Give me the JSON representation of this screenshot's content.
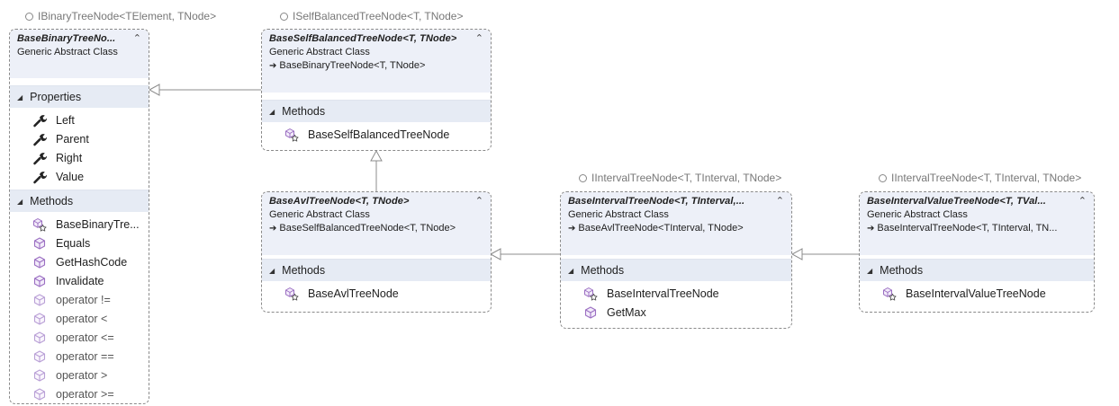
{
  "interfaces": {
    "binary": "IBinaryTreeNode<TElement, TNode>",
    "selfbal": "ISelfBalancedTreeNode<T, TNode>",
    "interval": "IIntervalTreeNode<T, TInterval, TNode>",
    "interval_value": "IIntervalTreeNode<T, TInterval, TNode>"
  },
  "classes": {
    "binary": {
      "title": "BaseBinaryTreeNo...",
      "kind": "Generic Abstract Class",
      "sections": {
        "properties": {
          "label": "Properties",
          "items": [
            {
              "name": "Left",
              "icon": "wrench-icon"
            },
            {
              "name": "Parent",
              "icon": "wrench-icon"
            },
            {
              "name": "Right",
              "icon": "wrench-icon"
            },
            {
              "name": "Value",
              "icon": "wrench-icon"
            }
          ]
        },
        "methods": {
          "label": "Methods",
          "items": [
            {
              "name": "BaseBinaryTre...",
              "icon": "constructor-icon"
            },
            {
              "name": "Equals",
              "icon": "method-icon"
            },
            {
              "name": "GetHashCode",
              "icon": "method-icon"
            },
            {
              "name": "Invalidate",
              "icon": "method-icon"
            },
            {
              "name": "operator !=",
              "icon": "method-icon"
            },
            {
              "name": "operator <",
              "icon": "method-icon"
            },
            {
              "name": "operator <=",
              "icon": "method-icon"
            },
            {
              "name": "operator ==",
              "icon": "method-icon"
            },
            {
              "name": "operator >",
              "icon": "method-icon"
            },
            {
              "name": "operator >=",
              "icon": "method-icon"
            }
          ]
        }
      }
    },
    "selfbal": {
      "title": "BaseSelfBalancedTreeNode<T, TNode>",
      "kind": "Generic Abstract Class",
      "base": "BaseBinaryTreeNode<T, TNode>",
      "methods_label": "Methods",
      "methods": [
        {
          "name": "BaseSelfBalancedTreeNode",
          "icon": "constructor-icon"
        }
      ]
    },
    "avl": {
      "title": "BaseAvlTreeNode<T, TNode>",
      "kind": "Generic Abstract Class",
      "base": "BaseSelfBalancedTreeNode<T, TNode>",
      "methods_label": "Methods",
      "methods": [
        {
          "name": "BaseAvlTreeNode",
          "icon": "constructor-icon"
        }
      ]
    },
    "interval": {
      "title": "BaseIntervalTreeNode<T, TInterval,...",
      "kind": "Generic Abstract Class",
      "base": "BaseAvlTreeNode<TInterval, TNode>",
      "methods_label": "Methods",
      "methods": [
        {
          "name": "BaseIntervalTreeNode",
          "icon": "constructor-icon"
        },
        {
          "name": "GetMax",
          "icon": "method-icon"
        }
      ]
    },
    "interval_value": {
      "title": "BaseIntervalValueTreeNode<T, TVal...",
      "kind": "Generic Abstract Class",
      "base": "BaseIntervalTreeNode<T, TInterval, TN...",
      "methods_label": "Methods",
      "methods": [
        {
          "name": "BaseIntervalValueTreeNode",
          "icon": "constructor-icon"
        }
      ]
    }
  },
  "glyphs": {
    "collapse": "⌃",
    "section_toggle": "◢",
    "inherit_arrow": "➔"
  },
  "colors": {
    "header_bg": "#edf0f8",
    "section_bg": "#e6ebf4",
    "border": "#8a8a8a",
    "icon_purple": "#9b6fc2"
  }
}
